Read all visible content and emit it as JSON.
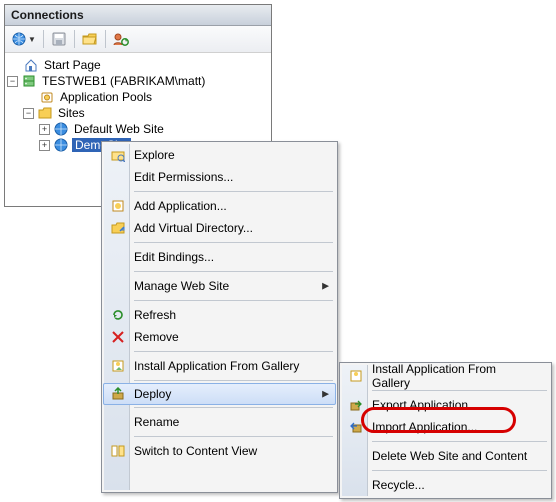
{
  "panel": {
    "title": "Connections"
  },
  "toolbar": {
    "icons": [
      "globe-icon",
      "save-icon",
      "folder-icon",
      "user-refresh-icon"
    ]
  },
  "tree": {
    "start_page": "Start Page",
    "server": "TESTWEB1 (FABRIKAM\\matt)",
    "app_pools": "Application Pools",
    "sites": "Sites",
    "default_site": "Default Web Site",
    "demo_site": "DemoSite"
  },
  "context_menu": {
    "explore": "Explore",
    "edit_permissions": "Edit Permissions...",
    "add_application": "Add Application...",
    "add_virtual_dir": "Add Virtual Directory...",
    "edit_bindings": "Edit Bindings...",
    "manage_web_site": "Manage Web Site",
    "refresh": "Refresh",
    "remove": "Remove",
    "install_from_gallery": "Install Application From Gallery",
    "deploy": "Deploy",
    "rename": "Rename",
    "switch_view": "Switch to Content View"
  },
  "deploy_submenu": {
    "install_from_gallery": "Install Application From Gallery",
    "export_app": "Export Application...",
    "import_app": "Import Application...",
    "delete_site": "Delete Web Site and Content",
    "recycle": "Recycle..."
  }
}
